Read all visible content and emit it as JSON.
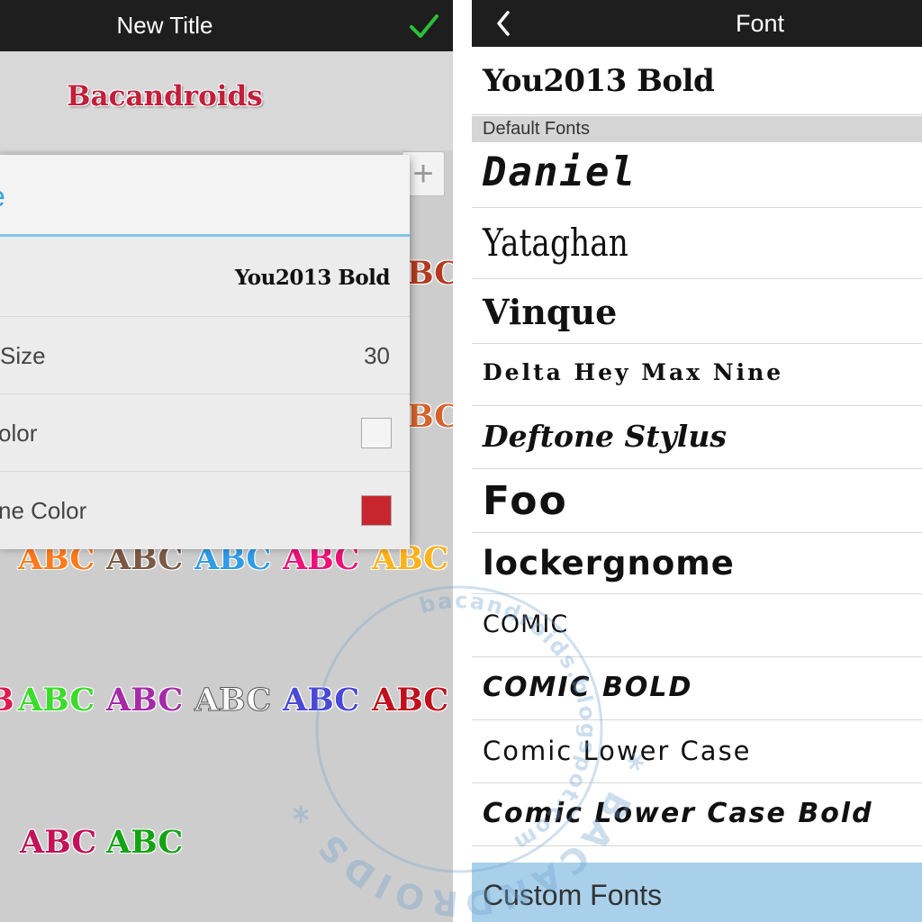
{
  "left": {
    "title": "New Title",
    "confirm_icon": "check-icon",
    "preview_text": "Bacandroids",
    "add_icon": "plus-icon",
    "add_symbol": "+",
    "dialog": {
      "title": "e",
      "font_value": "You2013 Bold",
      "size_label": "Size",
      "size_value": "30",
      "color_label": "olor",
      "color_value": "#f4f4f4",
      "outline_label": "ne Color",
      "outline_value": "#c8262e"
    },
    "samples": [
      {
        "text": "BC",
        "color": "#b33a1e"
      },
      {
        "text": "BC",
        "color": "#d4622b"
      },
      {
        "text": "ABC",
        "color": "#ff7a1a"
      },
      {
        "text": "ABC",
        "color": "#7a5a45"
      },
      {
        "text": "ABC",
        "color": "#2f9ce6"
      },
      {
        "text": "ABC",
        "color": "#ee1178"
      },
      {
        "text": "ABC",
        "color": "#ffb21a"
      },
      {
        "text": "B",
        "color": "#e0194f"
      },
      {
        "text": "ABC",
        "color": "#3adc2a"
      },
      {
        "text": "ABC",
        "color": "#a52aa8"
      },
      {
        "text": "ABC",
        "color": "#ffffff"
      },
      {
        "text": "ABC",
        "color": "#4a48d6"
      },
      {
        "text": "ABC",
        "color": "#c0101c"
      },
      {
        "text": "ABC",
        "color": "#c2125a"
      },
      {
        "text": "ABC",
        "color": "#13a413"
      }
    ]
  },
  "right": {
    "title": "Font",
    "back_icon": "chevron-left-icon",
    "current_font": "You2013 Bold",
    "section_header": "Default Fonts",
    "fonts": [
      "Daniel",
      "Yataghan",
      "Vinque",
      "Delta Hey Max Nine",
      "Deftone Stylus",
      "Foo",
      "lockergnome",
      "COMIC",
      "COMIC BOLD",
      "Comic Lower Case",
      "Comic Lower Case Bold"
    ],
    "custom_fonts": "Custom Fonts"
  },
  "watermark": {
    "text_outer": "* BACANDROIDS *",
    "text_inner": "bacandroids.blogspot.com"
  }
}
